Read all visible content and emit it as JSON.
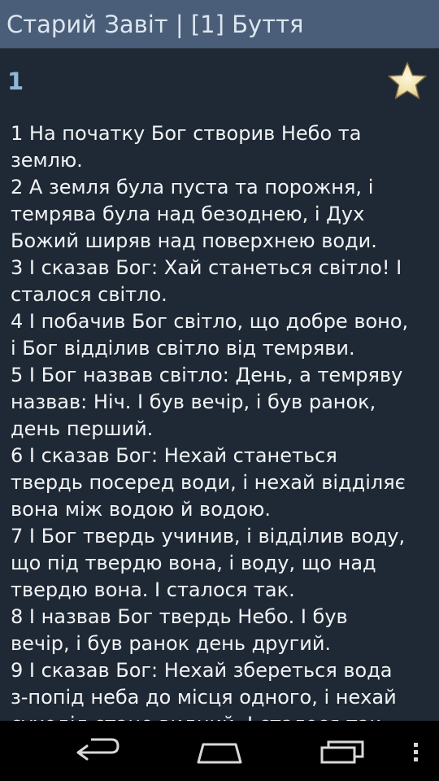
{
  "header": {
    "title": "Старий Завіт  |  [1] Буття"
  },
  "chapter": {
    "number": "1",
    "favorite_icon": "star-icon"
  },
  "verses": [
    [
      "1 На початку Бог створив Небо та",
      "землю."
    ],
    [
      "2 А земля була пуста та порожня, і",
      "темрява була над безоднею, і Дух",
      "Божий ширяв над поверхнею води."
    ],
    [
      "3 І сказав Бог: Хай станеться світло! І",
      "сталося світло."
    ],
    [
      "4 І побачив Бог світло, що добре воно,",
      "і Бог відділив світло від темряви."
    ],
    [
      "5 І Бог назвав світло: День, а темряву",
      "назвав: Ніч. І був вечір, і був ранок,",
      "день перший."
    ],
    [
      "6 І сказав Бог: Нехай станеться",
      "твердь посеред води, і нехай відділяє",
      "вона між водою й водою."
    ],
    [
      "7 І Бог твердь учинив, і відділив воду,",
      "що під твердю вона, і воду, що над",
      "твердю вона. І сталося так."
    ],
    [
      "8 І назвав Бог твердь Небо. І був",
      "вечір, і був ранок день другий."
    ],
    [
      "9 І сказав Бог: Нехай збереться вода",
      "з-попід неба до місця одного, і нехай",
      "суходіл стане видний. І сталося так."
    ]
  ],
  "nav": {
    "back_icon": "back-arrow-icon",
    "home_icon": "home-icon",
    "recents_icon": "recent-apps-icon",
    "menu_icon": "overflow-menu-icon"
  },
  "colors": {
    "title_bar": "#4a5e79",
    "background": "#1f2935",
    "chapter_number": "#8fb7d8",
    "text": "#f1f3f5",
    "star": "#f3e3b0"
  }
}
